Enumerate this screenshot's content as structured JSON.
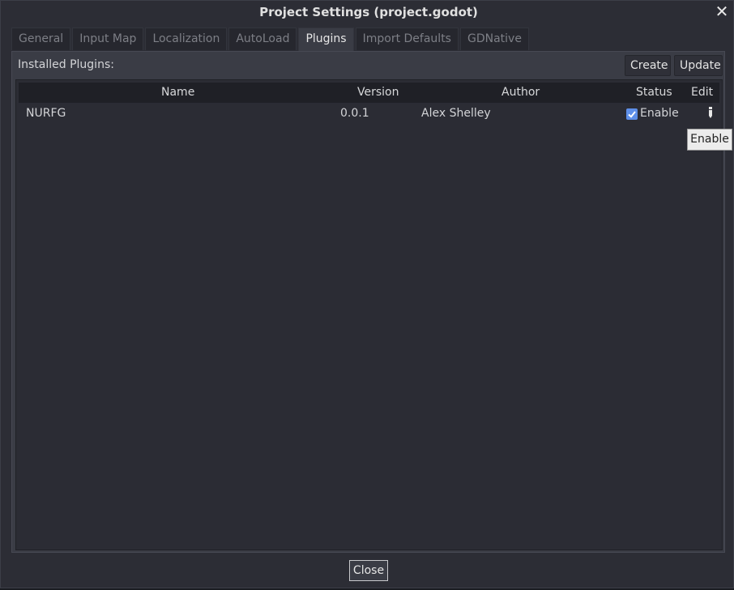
{
  "dialog": {
    "title": "Project Settings (project.godot)",
    "close_glyph": "✕",
    "close_button_label": "Close"
  },
  "tabs": [
    {
      "label": "General",
      "active": false
    },
    {
      "label": "Input Map",
      "active": false
    },
    {
      "label": "Localization",
      "active": false
    },
    {
      "label": "AutoLoad",
      "active": false
    },
    {
      "label": "Plugins",
      "active": true
    },
    {
      "label": "Import Defaults",
      "active": false
    },
    {
      "label": "GDNative",
      "active": false
    }
  ],
  "plugins": {
    "installed_label": "Installed Plugins:",
    "create_label": "Create",
    "update_label": "Update",
    "columns": {
      "name": "Name",
      "version": "Version",
      "author": "Author",
      "status": "Status",
      "edit": "Edit"
    },
    "rows": [
      {
        "name": "NURFG",
        "version": "0.0.1",
        "author": "Alex Shelley",
        "status_checked": true,
        "status_label": "Enable",
        "edit_icon": "edit-icon"
      }
    ],
    "tooltip": "Enable"
  },
  "colors": {
    "accent": "#5e8fe8",
    "background": "#2c2d35",
    "panel": "#3a3c45"
  }
}
